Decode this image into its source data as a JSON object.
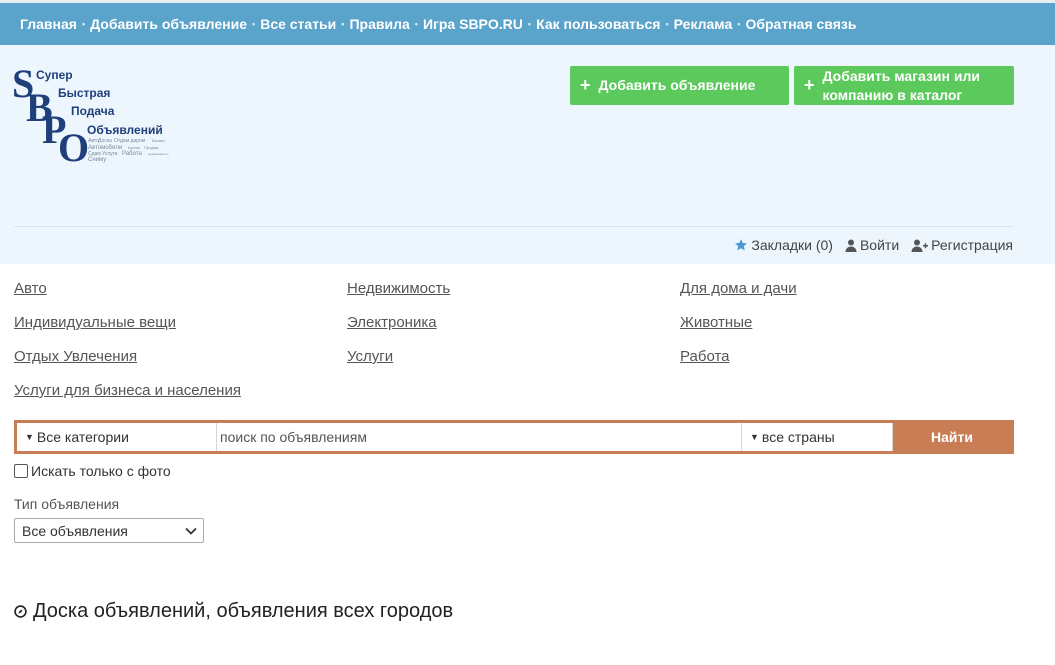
{
  "nav": {
    "items": [
      "Главная",
      "Добавить объявление",
      "Все статьи",
      "Правила",
      "Игра SBPO.RU",
      "Как пользоваться",
      "Реклама",
      "Обратная связь"
    ],
    "separator": "▪"
  },
  "logo": {
    "letters": [
      "S",
      "B",
      "P",
      "O"
    ],
    "lines": [
      "Супер",
      "Быстрая",
      "Подача",
      "Объявлений"
    ],
    "small_tags": [
      "Авто",
      "Доска",
      "Отдам даром",
      "Бизнес",
      "Автомобили",
      "Куплю",
      "Продам",
      "Сдам",
      "Услуги",
      "Работа",
      "Недвижимость",
      "Сниму"
    ]
  },
  "header": {
    "add_ad_label": "Добавить объявление",
    "add_shop_label_line1": "Добавить магазин или",
    "add_shop_label_line2": "компанию в каталог",
    "plus": "+"
  },
  "userbar": {
    "bookmarks": "Закладки (0)",
    "login": "Войти",
    "register": "Регистрация"
  },
  "categories": [
    "Авто",
    "Недвижимость",
    "Для дома и дачи",
    "Индивидуальные вещи",
    "Электроника",
    "Животные",
    "Отдых Увлечения",
    "Услуги",
    "Работа",
    "Услуги для бизнеса и населения"
  ],
  "search": {
    "category_value": "Все категории",
    "placeholder": "поиск по объявлениям",
    "country_value": "все страны",
    "find_label": "Найти"
  },
  "filters": {
    "photo_only": "Искать только с фото",
    "type_label": "Тип объявления",
    "type_value": "Все объявления"
  },
  "page_title": "Доска объявлений, объявления всех городов",
  "colors": {
    "nav": "#5aa3cb",
    "header_bg": "#eef6fd",
    "green": "#5cc95c",
    "search_accent": "#c97d55",
    "bookmark": "#4a9ad2",
    "logo_navy": "#1e3f7a"
  }
}
